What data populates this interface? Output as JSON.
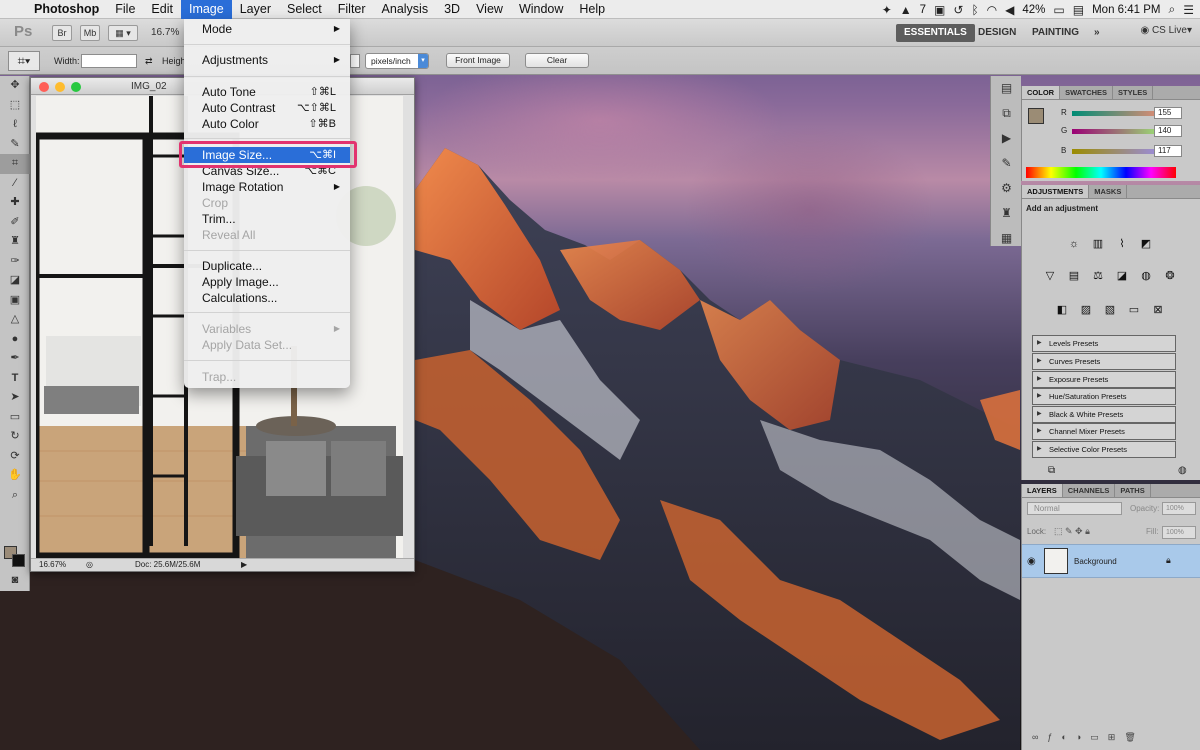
{
  "menubar": {
    "app": "Photoshop",
    "items": [
      "File",
      "Edit",
      "Image",
      "Layer",
      "Select",
      "Filter",
      "Analysis",
      "3D",
      "View",
      "Window",
      "Help"
    ],
    "active": "Image",
    "status": {
      "adobe_badge": "7",
      "battery": "42%",
      "clock": "Mon 6:41 PM"
    }
  },
  "appbar": {
    "logo": "Ps",
    "btn_br": "Br",
    "btn_mb": "Mb",
    "zoom": "16.7%",
    "workspaces": [
      "ESSENTIALS",
      "DESIGN",
      "PAINTING"
    ],
    "more": "»",
    "cslive": "CS Live"
  },
  "tool_options": {
    "width_label": "Width:",
    "height_label": "Heigh",
    "resolution_unit": "pixels/inch",
    "front_image": "Front Image",
    "clear": "Clear"
  },
  "document": {
    "title": "IMG_02",
    "zoom": "16.67%",
    "doc_info": "Doc: 25.6M/25.6M"
  },
  "image_menu": {
    "items": [
      {
        "label": "Mode",
        "submenu": true,
        "enabled": true
      },
      {
        "label": "Adjustments",
        "submenu": true,
        "enabled": true
      },
      {
        "label": "Auto Tone",
        "shortcut": "⇧⌘L",
        "enabled": true
      },
      {
        "label": "Auto Contrast",
        "shortcut": "⌥⇧⌘L",
        "enabled": true
      },
      {
        "label": "Auto Color",
        "shortcut": "⇧⌘B",
        "enabled": true
      },
      {
        "label": "Image Size...",
        "shortcut": "⌥⌘I",
        "enabled": true,
        "highlighted": true
      },
      {
        "label": "Canvas Size...",
        "shortcut": "⌥⌘C",
        "enabled": true
      },
      {
        "label": "Image Rotation",
        "submenu": true,
        "enabled": true
      },
      {
        "label": "Crop",
        "enabled": false
      },
      {
        "label": "Trim...",
        "enabled": true
      },
      {
        "label": "Reveal All",
        "enabled": false
      },
      {
        "label": "Duplicate...",
        "enabled": true
      },
      {
        "label": "Apply Image...",
        "enabled": true
      },
      {
        "label": "Calculations...",
        "enabled": true
      },
      {
        "label": "Variables",
        "submenu": true,
        "enabled": false
      },
      {
        "label": "Apply Data Set...",
        "enabled": false
      },
      {
        "label": "Trap...",
        "enabled": false
      }
    ]
  },
  "color_panel": {
    "tabs": [
      "COLOR",
      "SWATCHES",
      "STYLES"
    ],
    "channels": [
      {
        "label": "R",
        "value": "155"
      },
      {
        "label": "G",
        "value": "140"
      },
      {
        "label": "B",
        "value": "117"
      }
    ],
    "foreground": "#9b8c75"
  },
  "adjustments_panel": {
    "tabs": [
      "ADJUSTMENTS",
      "MASKS"
    ],
    "heading": "Add an adjustment",
    "presets": [
      "Levels Presets",
      "Curves Presets",
      "Exposure Presets",
      "Hue/Saturation Presets",
      "Black & White Presets",
      "Channel Mixer Presets",
      "Selective Color Presets"
    ]
  },
  "layers_panel": {
    "tabs": [
      "LAYERS",
      "CHANNELS",
      "PATHS"
    ],
    "blend_mode": "Normal",
    "opacity_label": "Opacity:",
    "opacity": "100%",
    "lock_label": "Lock:",
    "fill_label": "Fill:",
    "fill": "100%",
    "layer_name": "Background"
  },
  "colors": {
    "menu_highlight": "#2a6ed8",
    "callout": "#e2336f",
    "layer_selected": "#a9c9ea"
  }
}
